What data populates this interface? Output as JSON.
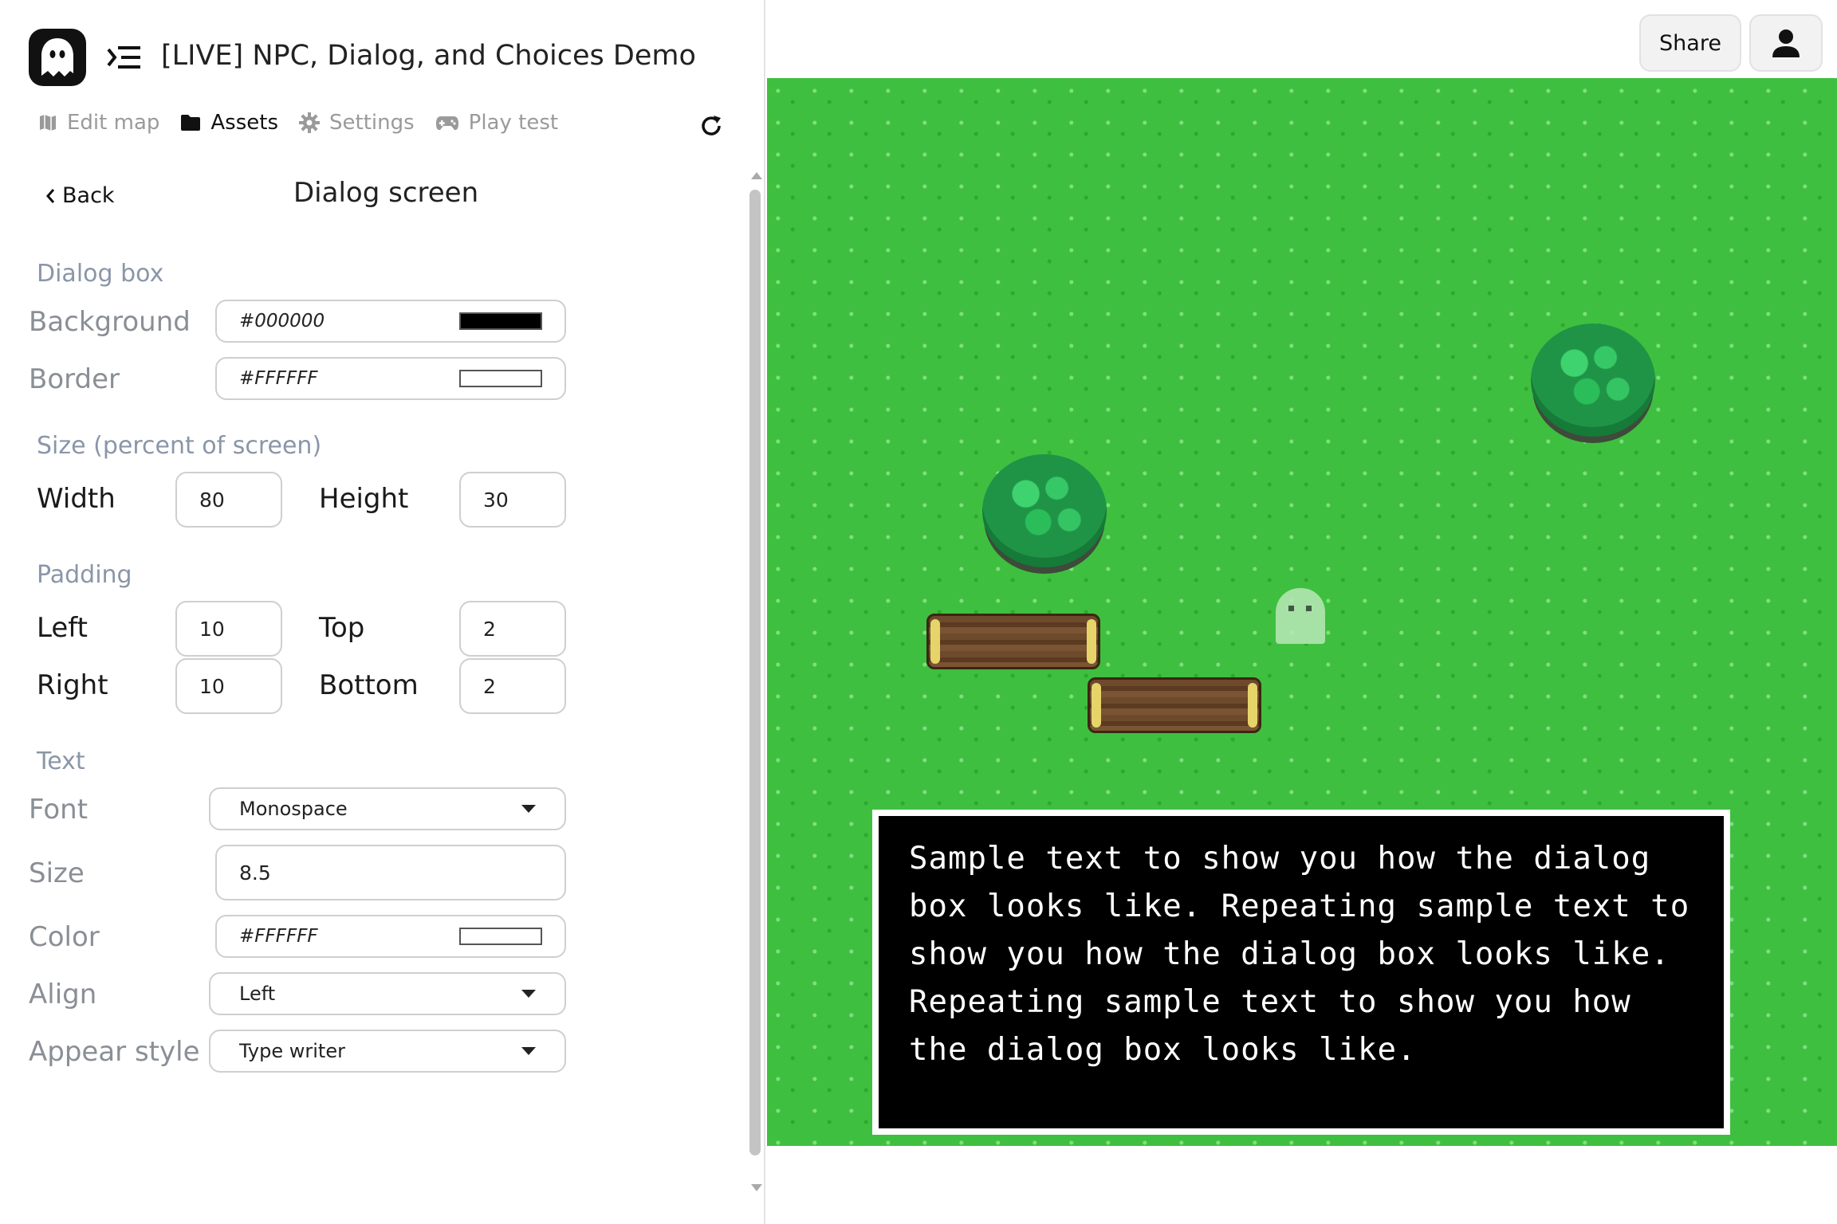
{
  "app": {
    "project_title": "[LIVE] NPC, Dialog, and Choices Demo"
  },
  "nav": {
    "tabs": [
      {
        "label": "Edit map",
        "icon": "map-icon",
        "active": false
      },
      {
        "label": "Assets",
        "icon": "folder-icon",
        "active": true
      },
      {
        "label": "Settings",
        "icon": "gear-icon",
        "active": false
      },
      {
        "label": "Play test",
        "icon": "gamepad-icon",
        "active": false
      }
    ]
  },
  "panel": {
    "back_label": "Back",
    "title": "Dialog screen"
  },
  "dialog_box": {
    "heading": "Dialog box",
    "background_label": "Background",
    "background_value": "#000000",
    "border_label": "Border",
    "border_value": "#FFFFFF"
  },
  "size": {
    "heading": "Size (percent of screen)",
    "width_label": "Width",
    "width_value": "80",
    "height_label": "Height",
    "height_value": "30"
  },
  "padding": {
    "heading": "Padding",
    "left_label": "Left",
    "left_value": "10",
    "top_label": "Top",
    "top_value": "2",
    "right_label": "Right",
    "right_value": "10",
    "bottom_label": "Bottom",
    "bottom_value": "2"
  },
  "text": {
    "heading": "Text",
    "font_label": "Font",
    "font_value": "Monospace",
    "size_label": "Size",
    "size_value": "8.5",
    "color_label": "Color",
    "color_value": "#FFFFFF",
    "align_label": "Align",
    "align_value": "Left",
    "appear_label": "Appear style",
    "appear_value": "Type writer"
  },
  "header": {
    "share_label": "Share"
  },
  "preview": {
    "dialog_text": "Sample text to show you how the dialog\nbox looks like. Repeating sample text to\nshow you how the dialog box looks like.\nRepeating sample text to show you how\nthe dialog box looks like."
  },
  "colors": {
    "grass": "#3fbf3f",
    "dialog_background": "#000000",
    "dialog_border": "#FFFFFF",
    "heading_gray": "#8a96a8"
  }
}
